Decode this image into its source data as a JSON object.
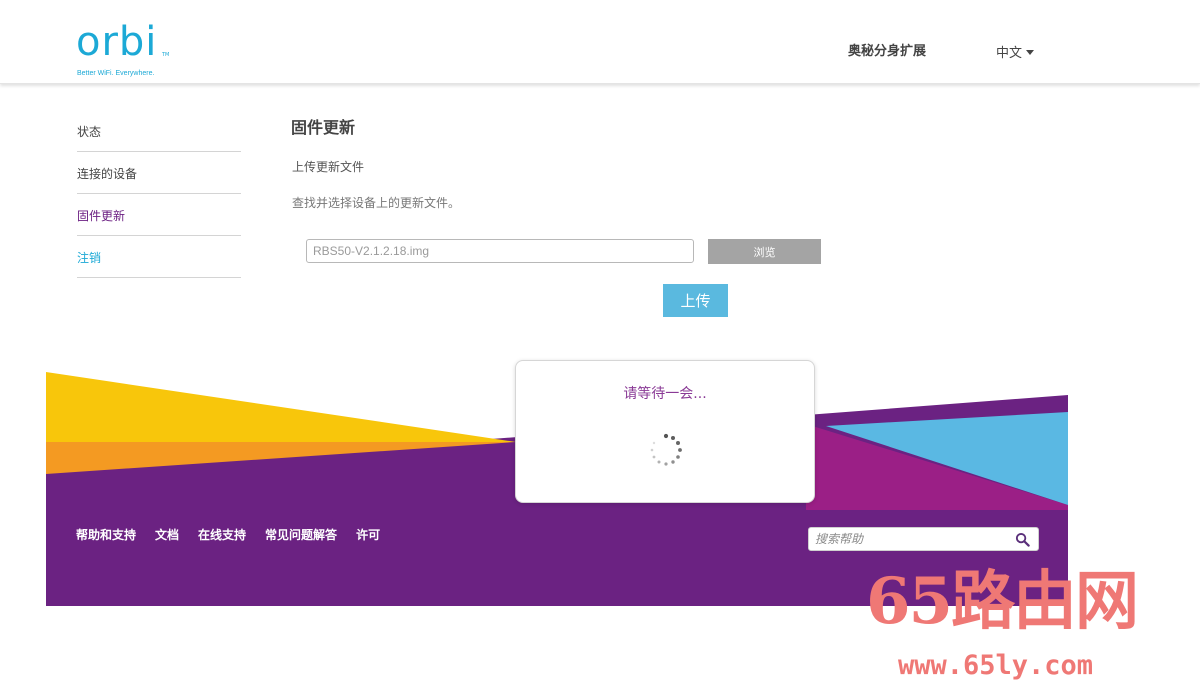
{
  "header": {
    "logo_text": "orbi",
    "logo_tm": "TM",
    "logo_tagline": "Better WiFi. Everywhere.",
    "extend_link": "奥秘分身扩展",
    "language": "中文"
  },
  "sidebar": {
    "items": [
      {
        "label": "状态"
      },
      {
        "label": "连接的设备"
      },
      {
        "label": "固件更新"
      },
      {
        "label": "注销"
      }
    ]
  },
  "main": {
    "title": "固件更新",
    "subtitle": "上传更新文件",
    "description": "查找并选择设备上的更新文件。",
    "file_value": "RBS50-V2.1.2.18.img",
    "browse_label": "浏览",
    "upload_label": "上传"
  },
  "modal": {
    "text": "请等待一会..."
  },
  "footer": {
    "links": [
      "帮助和支持",
      "文档",
      "在线支持",
      "常见问题解答",
      "许可"
    ],
    "search_placeholder": "搜索帮助"
  },
  "watermark": {
    "big": "65路由网",
    "small": "www.65ly.com"
  },
  "colors": {
    "brand_blue": "#1ca9d6",
    "purple": "#6b2282",
    "yellow": "#f8c60b",
    "orange": "#f49a22",
    "light_blue": "#5ab8e3",
    "magenta": "#9b1f86",
    "upload_button": "#5ab9df",
    "browse_button": "#a4a4a4",
    "watermark": "#ef7875"
  },
  "icons": {
    "search": "search-icon",
    "spinner": "spinner-icon",
    "caret": "caret-down-icon"
  }
}
